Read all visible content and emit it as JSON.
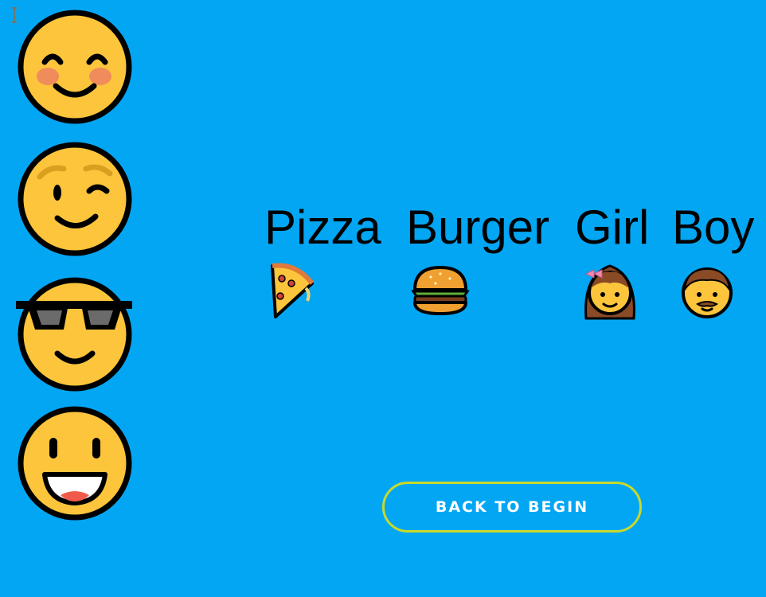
{
  "words": [
    {
      "label": "Pizza",
      "icon": "pizza-icon"
    },
    {
      "label": "Burger",
      "icon": "burger-icon"
    },
    {
      "label": "Girl",
      "icon": "girl-icon"
    },
    {
      "label": "Boy",
      "icon": "boy-icon"
    }
  ],
  "emoji_sidebar": [
    {
      "icon": "smiling-blush-face-icon"
    },
    {
      "icon": "winking-face-icon"
    },
    {
      "icon": "sunglasses-face-icon"
    },
    {
      "icon": "grinning-face-icon"
    }
  ],
  "actions": {
    "back_label": "BACK TO BEGIN"
  },
  "colors": {
    "background": "#03a6f3",
    "face": "#fcc53b",
    "outline": "#000000",
    "button_border": "#c8d92b",
    "button_text": "#ffffff"
  }
}
